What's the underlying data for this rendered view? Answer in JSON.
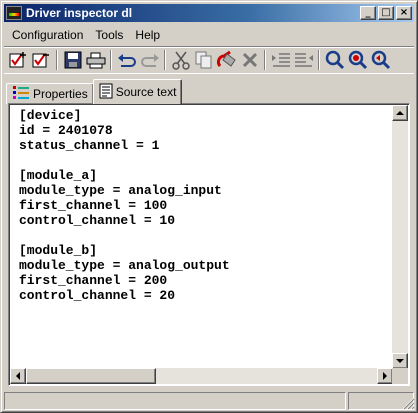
{
  "window": {
    "title": "Driver inspector dl"
  },
  "menu": [
    "Configuration",
    "Tools",
    "Help"
  ],
  "toolbar": [
    "check-add-icon",
    "check-remove-icon",
    "save-icon",
    "print-icon",
    "undo-icon",
    "redo-icon",
    "cut-icon",
    "copy-icon",
    "paste-icon",
    "delete-icon",
    "indent-icon",
    "outdent-icon",
    "find-icon",
    "find-next-icon",
    "find-previous-icon"
  ],
  "tabs": [
    {
      "label": "Properties",
      "icon": "properties-icon",
      "active": false
    },
    {
      "label": "Source text",
      "icon": "source-text-icon",
      "active": true
    }
  ],
  "editor": {
    "lines": [
      "[device]",
      "id = 2401078",
      "status_channel = 1",
      "",
      "[module_a]",
      "module_type = analog_input",
      "first_channel = 100",
      "control_channel = 10",
      "",
      "[module_b]",
      "module_type = analog_output",
      "first_channel = 200",
      "control_channel = 20"
    ]
  },
  "colors": {
    "titlebar_start": "#0a246a",
    "titlebar_end": "#a6caf0",
    "face": "#d4d0c8"
  }
}
